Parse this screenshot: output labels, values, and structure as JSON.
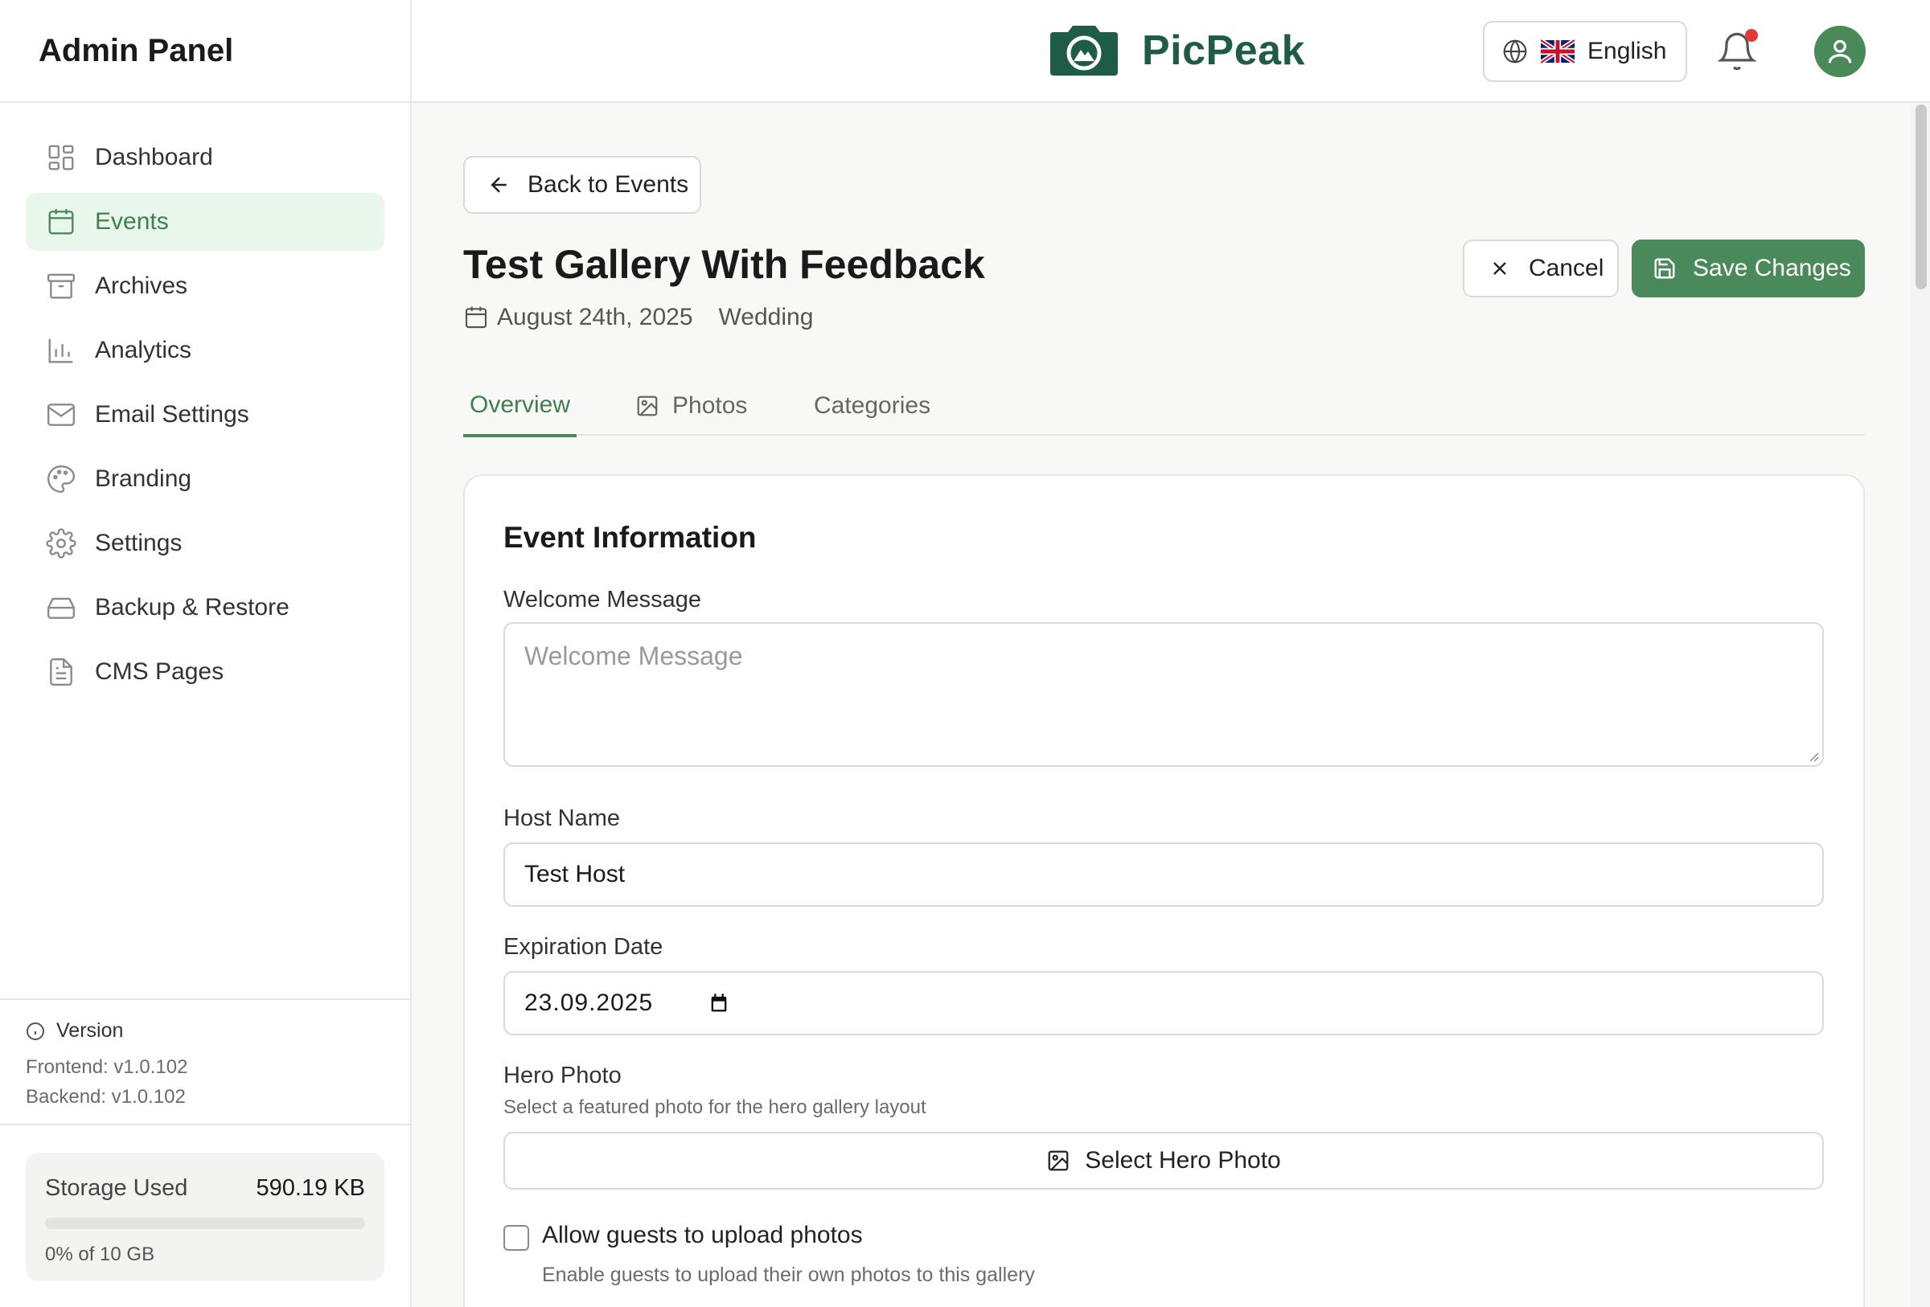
{
  "sidebar": {
    "title": "Admin Panel",
    "items": [
      {
        "label": "Dashboard",
        "icon": "dashboard-icon",
        "active": false
      },
      {
        "label": "Events",
        "icon": "calendar-icon",
        "active": true
      },
      {
        "label": "Archives",
        "icon": "archive-icon",
        "active": false
      },
      {
        "label": "Analytics",
        "icon": "bar-chart-icon",
        "active": false
      },
      {
        "label": "Email Settings",
        "icon": "mail-icon",
        "active": false
      },
      {
        "label": "Branding",
        "icon": "palette-icon",
        "active": false
      },
      {
        "label": "Settings",
        "icon": "gear-icon",
        "active": false
      },
      {
        "label": "Backup & Restore",
        "icon": "hard-drive-icon",
        "active": false
      },
      {
        "label": "CMS Pages",
        "icon": "file-text-icon",
        "active": false
      }
    ],
    "version": {
      "title": "Version",
      "frontend": "Frontend: v1.0.102",
      "backend": "Backend: v1.0.102"
    },
    "storage": {
      "label": "Storage Used",
      "value": "590.19 KB",
      "percent_text": "0% of 10 GB",
      "percent": 0
    }
  },
  "topbar": {
    "brand": "PicPeak",
    "language": "English",
    "notification_dot": true
  },
  "page": {
    "back_label": "Back to Events",
    "title": "Test Gallery With Feedback",
    "date": "August 24th, 2025",
    "event_type": "Wedding",
    "cancel_label": "Cancel",
    "save_label": "Save Changes",
    "tabs": [
      {
        "label": "Overview",
        "active": true
      },
      {
        "label": "Photos",
        "active": false
      },
      {
        "label": "Categories",
        "active": false
      }
    ]
  },
  "form": {
    "section_title": "Event Information",
    "welcome_label": "Welcome Message",
    "welcome_placeholder": "Welcome Message",
    "host_label": "Host Name",
    "host_value": "Test Host",
    "expiration_label": "Expiration Date",
    "expiration_value": "23.09.2025",
    "hero_label": "Hero Photo",
    "hero_hint": "Select a featured photo for the hero gallery layout",
    "hero_button": "Select Hero Photo",
    "upload_label": "Allow guests to upload photos",
    "upload_hint": "Enable guests to upload their own photos to this gallery",
    "upload_checked": false
  },
  "colors": {
    "accent": "#4a8a5a",
    "brand": "#1f5c48",
    "active_bg": "#e9f6ec",
    "notification": "#e53935"
  }
}
